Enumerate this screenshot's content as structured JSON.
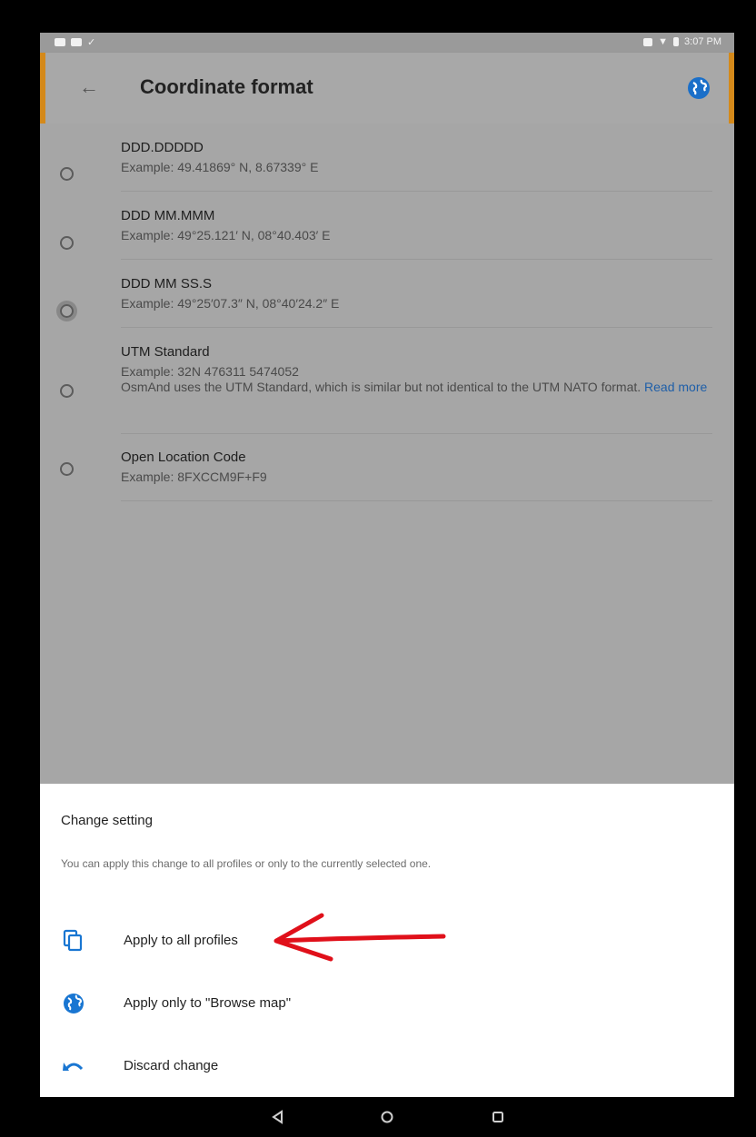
{
  "status_bar": {
    "time": "3:07 PM"
  },
  "toolbar": {
    "title": "Coordinate format",
    "back_icon": "arrow-back-icon",
    "profile_icon": "globe-icon"
  },
  "options": [
    {
      "title": "DDD.DDDDD",
      "desc": "Example: 49.41869° N, 8.67339° E",
      "selected": false
    },
    {
      "title": "DDD MM.MMM",
      "desc": "Example: 49°25.121′ N, 08°40.403′ E",
      "selected": false
    },
    {
      "title": "DDD MM SS.S",
      "desc": "Example: 49°25′07.3″ N, 08°40′24.2″ E",
      "selected": false,
      "pressed": true
    },
    {
      "title": "UTM Standard",
      "desc": "Example: 32N 476311 5474052",
      "desc2": "OsmAnd uses the UTM Standard, which is similar but not identical to the UTM NATO format.",
      "link": "Read more",
      "selected": false
    },
    {
      "title": "Open Location Code",
      "desc": "Example: 8FXCCM9F+F9",
      "selected": false
    }
  ],
  "sheet": {
    "title": "Change setting",
    "description": "You can apply this change to all profiles or only to the currently selected one.",
    "actions": [
      {
        "label": "Apply to all profiles",
        "icon": "copy-icon"
      },
      {
        "label": "Apply only to \"Browse map\"",
        "icon": "globe-icon"
      },
      {
        "label": "Discard change",
        "icon": "undo-icon"
      }
    ]
  },
  "colors": {
    "accent": "#1976d2",
    "toolbar_edge": "#d4891a",
    "annotation_arrow": "#e0101a"
  }
}
